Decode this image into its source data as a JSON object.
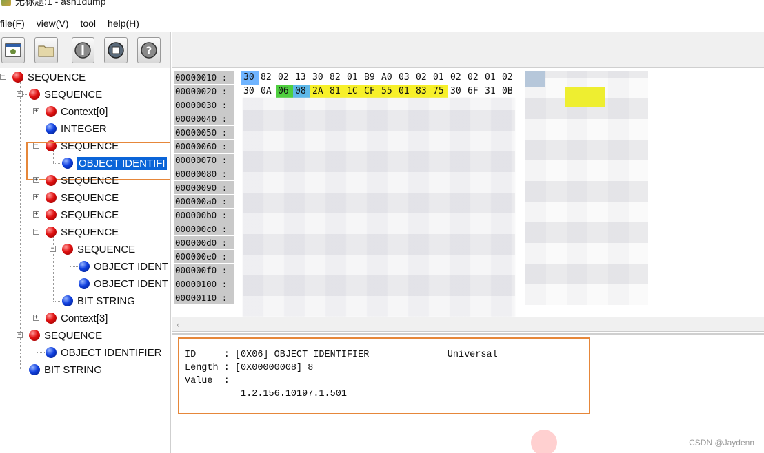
{
  "window": {
    "title": "无标题:1 - asn1dump"
  },
  "menu": {
    "items": [
      "file(F)",
      "view(V)",
      "tool",
      "help(H)"
    ]
  },
  "tree": {
    "nodes": [
      {
        "label": "SEQUENCE",
        "color": "red"
      },
      {
        "label": "SEQUENCE",
        "color": "red"
      },
      {
        "label": "Context[0]",
        "color": "red"
      },
      {
        "label": "INTEGER",
        "color": "blue"
      },
      {
        "label": "SEQUENCE",
        "color": "red"
      },
      {
        "label": "OBJECT IDENTIFI",
        "color": "blue"
      },
      {
        "label": "SEQUENCE",
        "color": "red"
      },
      {
        "label": "SEQUENCE",
        "color": "red"
      },
      {
        "label": "SEQUENCE",
        "color": "red"
      },
      {
        "label": "SEQUENCE",
        "color": "red"
      },
      {
        "label": "SEQUENCE",
        "color": "red"
      },
      {
        "label": "OBJECT IDENT",
        "color": "blue"
      },
      {
        "label": "OBJECT IDENT",
        "color": "blue"
      },
      {
        "label": "BIT STRING",
        "color": "blue"
      },
      {
        "label": "Context[3]",
        "color": "red"
      },
      {
        "label": "SEQUENCE",
        "color": "red"
      },
      {
        "label": "OBJECT IDENTIFIER",
        "color": "blue"
      },
      {
        "label": "BIT STRING",
        "color": "blue"
      }
    ]
  },
  "hex": {
    "offsets": [
      "00000010 :",
      "00000020 :",
      "00000030 :",
      "00000040 :",
      "00000050 :",
      "00000060 :",
      "00000070 :",
      "00000080 :",
      "00000090 :",
      "000000a0 :",
      "000000b0 :",
      "000000c0 :",
      "000000d0 :",
      "000000e0 :",
      "000000f0 :",
      "00000100 :",
      "00000110 :"
    ],
    "row1": [
      "30",
      "82",
      "02",
      "13",
      "30",
      "82",
      "01",
      "B9",
      "A0",
      "03",
      "02",
      "01",
      "02",
      "02",
      "01",
      "02"
    ],
    "row2": [
      "30",
      "0A",
      "06",
      "08",
      "2A",
      "81",
      "1C",
      "CF",
      "55",
      "01",
      "83",
      "75",
      "30",
      "6F",
      "31",
      "0B"
    ]
  },
  "detail": {
    "line1": "ID     : [0X06] OBJECT IDENTIFIER              Universal",
    "line2": "Length : [0X00000008] 8",
    "line3": "Value  :",
    "line4": "          1.2.156.10197.1.501"
  },
  "watermark": "CSDN @Jaydenn",
  "colors": {
    "selection": "#0a64d8",
    "highlight_border": "#e6873a",
    "hex_green": "#4fcf3f",
    "hex_yellow": "#f7f02a",
    "hex_cyan": "#5db8e8"
  }
}
